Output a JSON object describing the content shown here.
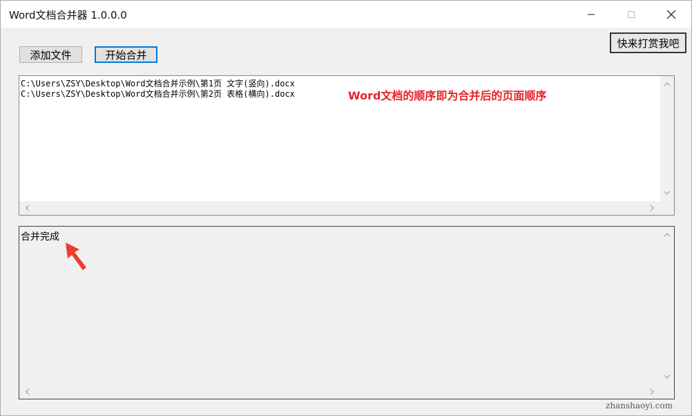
{
  "window": {
    "title": "Word文档合并器 1.0.0.0"
  },
  "toolbar": {
    "add_label": "添加文件",
    "merge_label": "开始合并",
    "tip_label": "快来打赏我吧"
  },
  "file_list": {
    "items": [
      "C:\\Users\\ZSY\\Desktop\\Word文档合并示例\\第1页 文字(竖向).docx",
      "C:\\Users\\ZSY\\Desktop\\Word文档合并示例\\第2页 表格(横向).docx"
    ]
  },
  "annotation": {
    "text": "Word文档的顺序即为合并后的页面顺序",
    "color": "#e8202a"
  },
  "log": {
    "text": "合并完成"
  },
  "watermark": {
    "text": "zhanshaoyi.com"
  },
  "icons": {
    "minimize": "minimize-icon",
    "maximize": "maximize-icon",
    "close": "close-icon",
    "pointer": "red-arrow-icon"
  },
  "colors": {
    "accent": "#0078d7",
    "annotation": "#e8202a",
    "window_bg": "#f0f0f0"
  }
}
